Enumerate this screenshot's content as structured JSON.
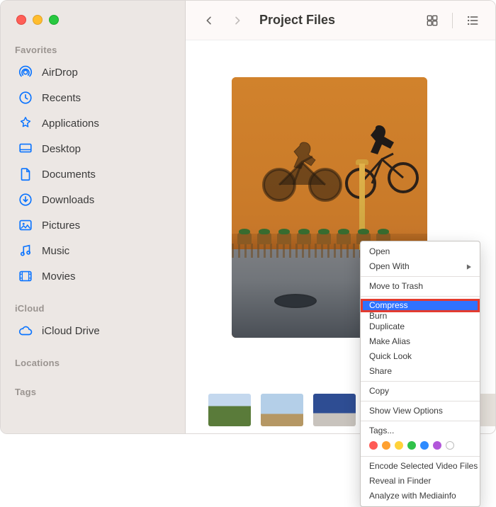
{
  "window": {
    "title": "Project Files"
  },
  "sidebar": {
    "sections": {
      "favorites": {
        "title": "Favorites",
        "items": [
          {
            "label": "AirDrop"
          },
          {
            "label": "Recents"
          },
          {
            "label": "Applications"
          },
          {
            "label": "Desktop"
          },
          {
            "label": "Documents"
          },
          {
            "label": "Downloads"
          },
          {
            "label": "Pictures"
          },
          {
            "label": "Music"
          },
          {
            "label": "Movies"
          }
        ]
      },
      "icloud": {
        "title": "iCloud",
        "items": [
          {
            "label": "iCloud Drive"
          }
        ]
      },
      "locations": {
        "title": "Locations"
      },
      "tags": {
        "title": "Tags"
      }
    }
  },
  "context_menu": {
    "open": "Open",
    "open_with": "Open With",
    "move_to_trash": "Move to Trash",
    "compress": "Compress",
    "burn": "Burn",
    "duplicate": "Duplicate",
    "make_alias": "Make Alias",
    "quick_look": "Quick Look",
    "share": "Share",
    "copy": "Copy",
    "show_view_options": "Show View Options",
    "tags": "Tags...",
    "tag_colors": [
      "#ff5b56",
      "#ffa030",
      "#ffd23a",
      "#30c24a",
      "#2e8bff",
      "#b257da"
    ],
    "encode": "Encode Selected Video Files",
    "reveal": "Reveal in Finder",
    "analyze": "Analyze with Mediainfo"
  }
}
